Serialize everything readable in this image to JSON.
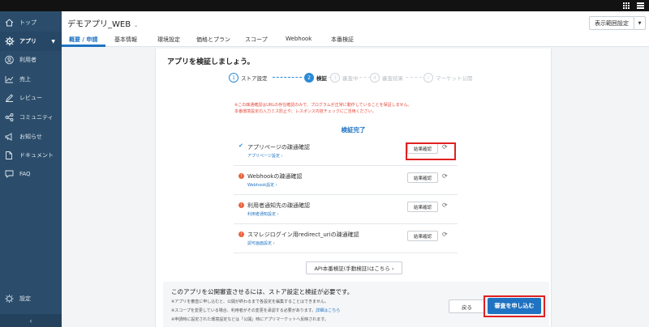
{
  "sidebar": {
    "items": [
      {
        "label": "トップ",
        "icon": "home-icon"
      },
      {
        "label": "アプリ",
        "icon": "gear-icon"
      },
      {
        "label": "利用者",
        "icon": "user-icon"
      },
      {
        "label": "売上",
        "icon": "chart-icon"
      },
      {
        "label": "レビュー",
        "icon": "pencil-icon"
      },
      {
        "label": "コミュニティ",
        "icon": "share-icon"
      },
      {
        "label": "お知らせ",
        "icon": "megaphone-icon"
      },
      {
        "label": "ドキュメント",
        "icon": "document-icon"
      },
      {
        "label": "FAQ",
        "icon": "faq-icon"
      }
    ],
    "settings": "設定",
    "collapse": "‹"
  },
  "header": {
    "app_title": "デモアプリ_WEB",
    "scope_button": "表示範囲設定",
    "tabs": [
      "概要 / 申請",
      "基本情報",
      "環境設定",
      "価格とプラン",
      "スコープ",
      "Webhook",
      "本番検証"
    ]
  },
  "card": {
    "title": "アプリを検証しましょう。",
    "steps": [
      {
        "num": "1",
        "label": "ストア設定"
      },
      {
        "num": "2",
        "label": "検証"
      },
      {
        "num": "3",
        "label": "審査中"
      },
      {
        "num": "4",
        "label": "審査結果"
      },
      {
        "num": "✓",
        "label": "マーケット公開"
      }
    ],
    "warning_line1": "※この疎通確認はURLの存在確認のみで、プログラムが正常に動作していることを保証しません。",
    "warning_line2": "本番環境設定の入力ミス防止や、レスポンス内容チェックにご活用ください。",
    "complete_label": "検証完了",
    "checks": [
      {
        "name": "アプリページの疎通確認",
        "link": "アプリページ設定 ›",
        "button": "結果確認"
      },
      {
        "name": "Webhookの疎通確認",
        "link": "Webhook設定 ›",
        "button": "結果確認"
      },
      {
        "name": "利用者通知先の疎通確認",
        "link": "利用者通知設定 ›",
        "button": "結果確認"
      },
      {
        "name": "スマレジログイン用redirect_uriの疎通確認",
        "link": "認可画面設定 ›",
        "button": "結果確認"
      }
    ],
    "api_button": "API本番検証(手動検証)はこちら ›"
  },
  "footer": {
    "main": "このアプリを公開審査させるには、ストア設定と検証が必要です。",
    "note1": "※アプリを審査に申し込むと、公開が終わるまで各設定を編集することはできません。",
    "note2": "※スコープを変更している場合、利用者がその変更を承認する必要があります。",
    "note2_link": "詳細はこちら",
    "note3": "※申請時に設定された環境設定などは「公開」時にアプリマーケットへ反映されます。",
    "back_button": "戻る",
    "submit_button": "審査を申し込む"
  },
  "colors": {
    "accent": "#1f73c2",
    "sidebar": "#2b4d6b",
    "error": "#e54b3c",
    "highlight": "#e02020"
  }
}
